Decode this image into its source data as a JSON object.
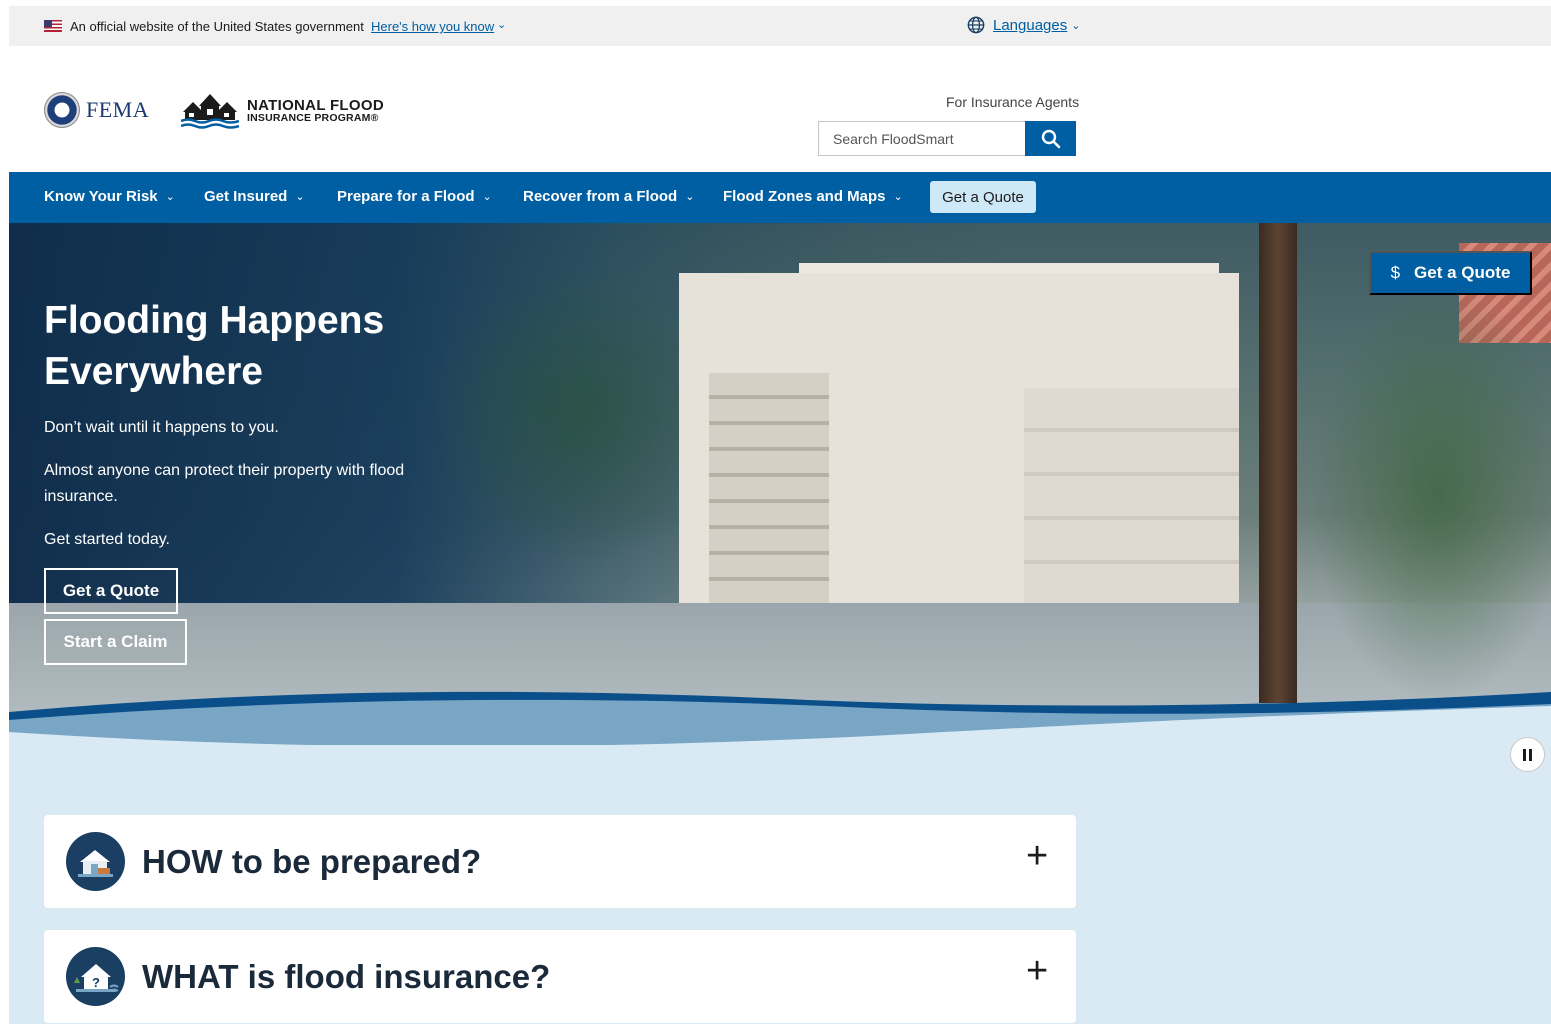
{
  "banner": {
    "official_text": "An official website of the United States government",
    "how_link": "Here's how you know",
    "languages_label": "Languages"
  },
  "header": {
    "fema_logo_text": "FEMA",
    "nfip_line1": "NATIONAL FLOOD",
    "nfip_line2": "INSURANCE PROGRAM®",
    "agents_link": "For Insurance Agents",
    "search_placeholder": "Search FloodSmart"
  },
  "nav": {
    "items": [
      {
        "label": "Know Your Risk"
      },
      {
        "label": "Get Insured"
      },
      {
        "label": "Prepare for a Flood"
      },
      {
        "label": "Recover from a Flood"
      },
      {
        "label": "Flood Zones and Maps"
      }
    ],
    "quote_label": "Get a Quote"
  },
  "hero": {
    "title": "Flooding Happens Everywhere",
    "p1": "Don’t wait until it happens to you.",
    "p2": "Almost anyone can protect their property with flood insurance.",
    "p3": "Get started today.",
    "btn_quote": "Get a Quote",
    "btn_claim": "Start a Claim",
    "side_quote": "Get a Quote",
    "side_quote_symbol": "$"
  },
  "accordion": [
    {
      "title": "HOW to be prepared?",
      "icon": "house-prepared-icon"
    },
    {
      "title": "WHAT is flood insurance?",
      "icon": "house-question-icon"
    }
  ],
  "colors": {
    "primary": "#005ea2",
    "hero_dark": "#0e2c4a",
    "lower_bg": "#d9eaf4",
    "nav_quote_bg": "#cfe8f7"
  }
}
